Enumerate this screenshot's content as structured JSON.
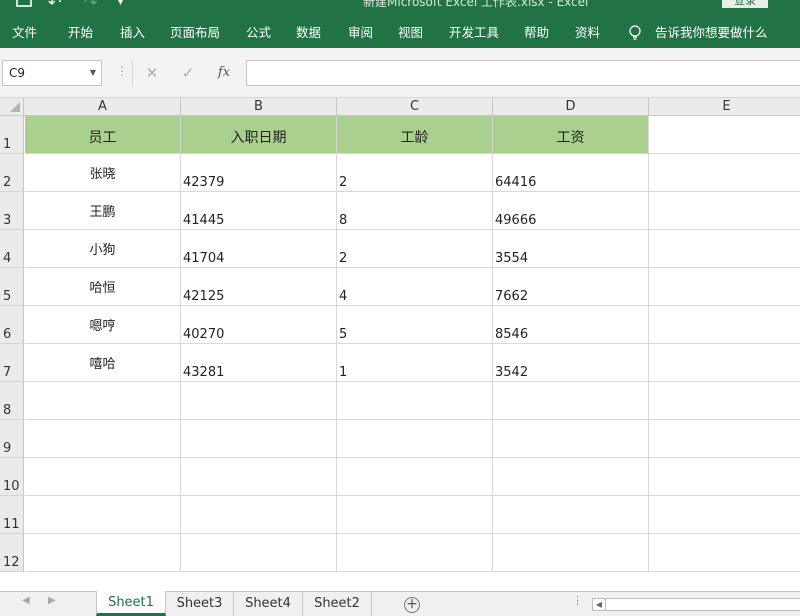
{
  "title_bar": {
    "window_title": "新建Microsoft Excel 工作表.xlsx  -  Excel",
    "login_label": "登录"
  },
  "ribbon": {
    "tabs": [
      "文件",
      "开始",
      "插入",
      "页面布局",
      "公式",
      "数据",
      "审阅",
      "视图",
      "开发工具",
      "帮助",
      "资料"
    ],
    "tell_me": "告诉我你想要做什么"
  },
  "formula_bar": {
    "name_box": "C9",
    "fx_label": "fx",
    "formula": ""
  },
  "grid": {
    "columns": [
      "A",
      "B",
      "C",
      "D",
      "E"
    ],
    "rows": [
      "1",
      "2",
      "3",
      "4",
      "5",
      "6",
      "7",
      "8",
      "9",
      "10",
      "11",
      "12"
    ],
    "header": [
      "员工",
      "入职日期",
      "工龄",
      "工资"
    ],
    "data": [
      [
        "张晓",
        "42379",
        "2",
        "64416"
      ],
      [
        "王鹏",
        "41445",
        "8",
        "49666"
      ],
      [
        "小狗",
        "41704",
        "2",
        "3554"
      ],
      [
        "哈恒",
        "42125",
        "4",
        "7662"
      ],
      [
        "嗯哼",
        "40270",
        "5",
        "8546"
      ],
      [
        "嘻哈",
        "43281",
        "1",
        "3542"
      ]
    ],
    "header_color": "#a9d08e"
  },
  "sheets": {
    "tabs": [
      "Sheet1",
      "Sheet3",
      "Sheet4",
      "Sheet2"
    ],
    "active": "Sheet1"
  },
  "accent_color": "#217346"
}
